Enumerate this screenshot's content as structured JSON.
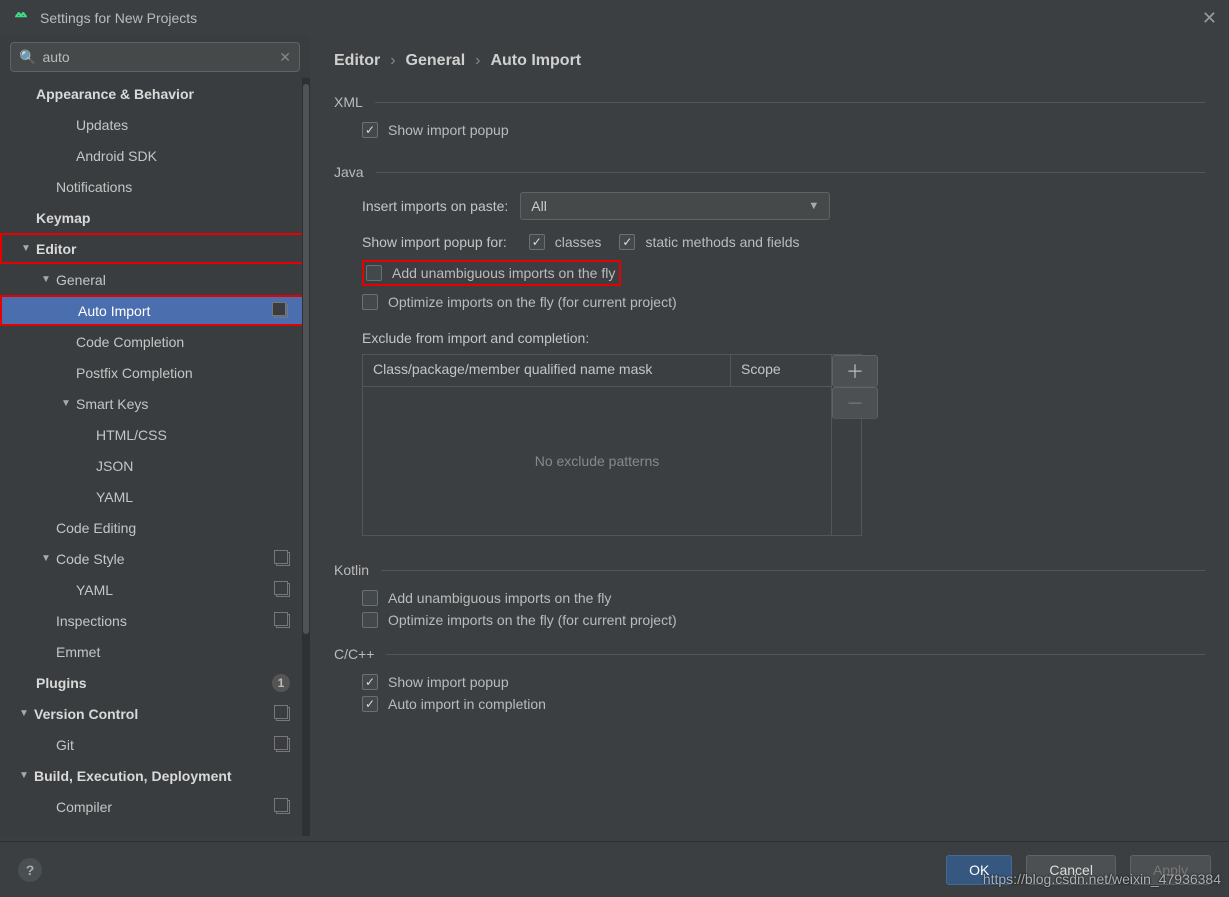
{
  "window": {
    "title": "Settings for New Projects"
  },
  "search": {
    "value": "auto"
  },
  "tree": {
    "appearance": "Appearance & Behavior",
    "updates": "Updates",
    "androidsdk": "Android SDK",
    "notifications": "Notifications",
    "keymap": "Keymap",
    "editor": "Editor",
    "general": "General",
    "autoimport": "Auto Import",
    "codecompletion": "Code Completion",
    "postfix": "Postfix Completion",
    "smartkeys": "Smart Keys",
    "htmlcss": "HTML/CSS",
    "json": "JSON",
    "yaml": "YAML",
    "codeediting": "Code Editing",
    "codestyle": "Code Style",
    "yaml2": "YAML",
    "inspections": "Inspections",
    "emmet": "Emmet",
    "plugins": "Plugins",
    "plugins_badge": "1",
    "versioncontrol": "Version Control",
    "git": "Git",
    "bed": "Build, Execution, Deployment",
    "compiler": "Compiler"
  },
  "crumbs": {
    "a": "Editor",
    "b": "General",
    "c": "Auto Import",
    "sep": "›"
  },
  "sections": {
    "xml": "XML",
    "java": "Java",
    "kotlin": "Kotlin",
    "ccpp": "C/C++"
  },
  "xml": {
    "show": "Show import popup"
  },
  "java": {
    "insert_label": "Insert imports on paste:",
    "insert_value": "All",
    "popup_label": "Show import popup for:",
    "classes": "classes",
    "static": "static methods and fields",
    "add_fly": "Add unambiguous imports on the fly",
    "optimize_fly": "Optimize imports on the fly (for current project)",
    "exclude_label": "Exclude from import and completion:",
    "th_name": "Class/package/member qualified name mask",
    "th_scope": "Scope",
    "empty": "No exclude patterns"
  },
  "kotlin": {
    "add_fly": "Add unambiguous imports on the fly",
    "optimize_fly": "Optimize imports on the fly (for current project)"
  },
  "ccpp": {
    "show": "Show import popup",
    "auto": "Auto import in completion"
  },
  "buttons": {
    "ok": "OK",
    "cancel": "Cancel",
    "apply": "Apply"
  },
  "watermark": "https://blog.csdn.net/weixin_47936384"
}
